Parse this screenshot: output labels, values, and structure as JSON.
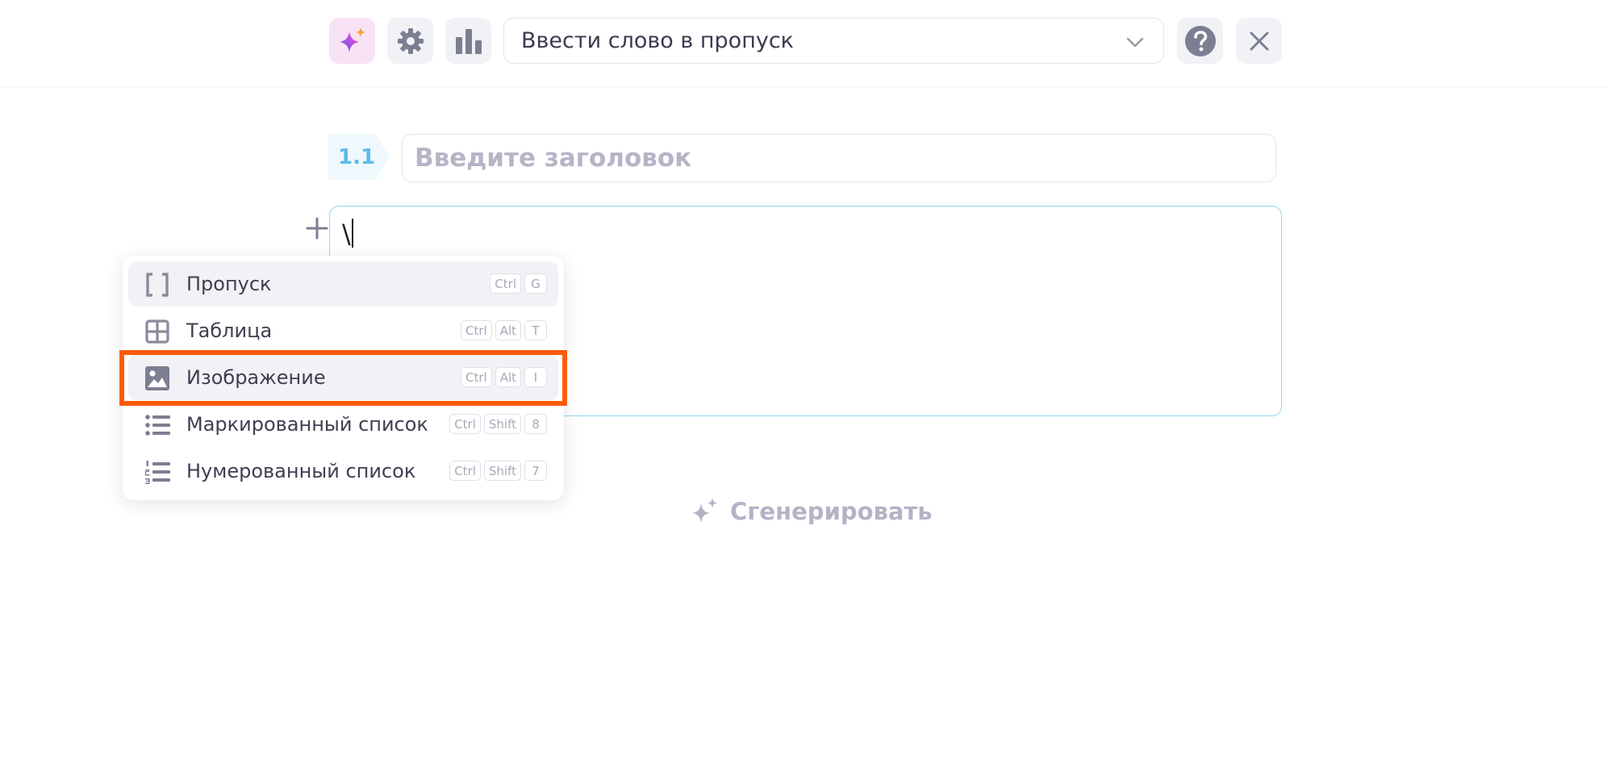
{
  "toolbar": {
    "ai_icon": "sparkle-icon",
    "settings_icon": "gear-icon",
    "stats_icon": "bar-chart-icon",
    "mode_select_value": "Ввести слово в пропуск",
    "help_icon": "question-icon",
    "close_icon": "close-icon"
  },
  "question": {
    "number": "1.1",
    "title_placeholder": "Введите заголовок",
    "title_value": "",
    "body_text": "\\"
  },
  "insert_menu": {
    "items": [
      {
        "label": "Пропуск",
        "icon": "brackets-icon",
        "keys": [
          "Ctrl",
          "G"
        ]
      },
      {
        "label": "Таблица",
        "icon": "table-icon",
        "keys": [
          "Ctrl",
          "Alt",
          "T"
        ]
      },
      {
        "label": "Изображение",
        "icon": "image-icon",
        "keys": [
          "Ctrl",
          "Alt",
          "I"
        ]
      },
      {
        "label": "Маркированный список",
        "icon": "bullet-list-icon",
        "keys": [
          "Ctrl",
          "Shift",
          "8"
        ]
      },
      {
        "label": "Нумерованный список",
        "icon": "numbered-list-icon",
        "keys": [
          "Ctrl",
          "Shift",
          "7"
        ]
      }
    ]
  },
  "generate_button": {
    "label": "Сгенерировать",
    "icon": "sparkle-icon"
  },
  "colors": {
    "accent_cyan": "#5bbcec",
    "highlight_orange": "#ff5a0a",
    "muted_text": "#b3b3c6"
  }
}
